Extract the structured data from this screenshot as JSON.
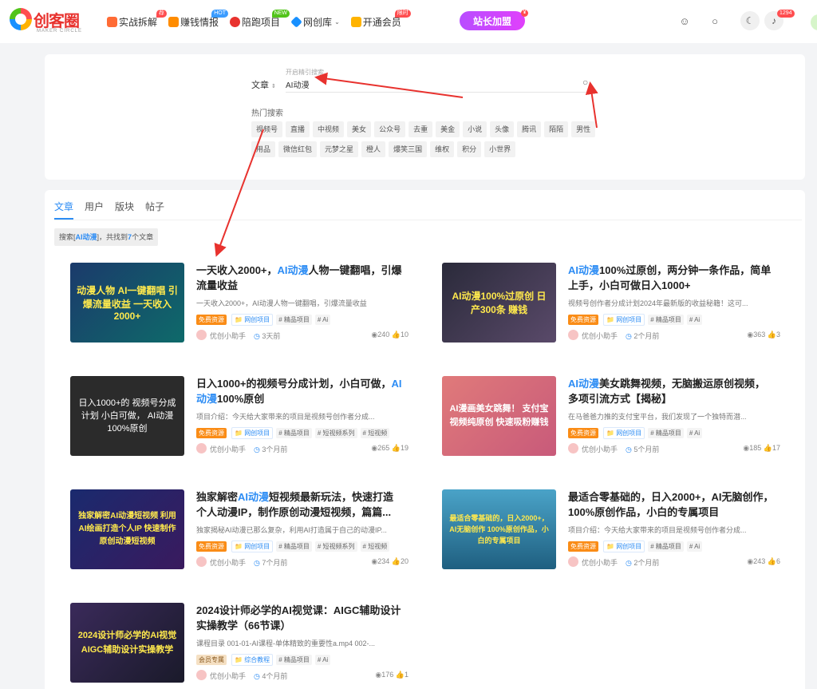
{
  "logo": {
    "name": "创客圈",
    "sub": "MAKER CIRCLE"
  },
  "nav": [
    {
      "label": "实战拆解",
      "badge": "荐",
      "badge_color": "#ff4d4f",
      "icon_color": "#ff6b35"
    },
    {
      "label": "赚钱情报",
      "badge": "HOT",
      "badge_color": "#3b9cff",
      "icon_color": "#ff8c00"
    },
    {
      "label": "陪跑项目",
      "badge": "NEW",
      "badge_color": "#52c41a",
      "icon_color": "#e8322e"
    },
    {
      "label": "网创库",
      "badge": "",
      "badge_color": "",
      "icon_color": "#1890ff",
      "dropdown": true
    },
    {
      "label": "开通会员",
      "badge": "限时",
      "badge_color": "#ff4d4f",
      "icon_color": "#ffb300"
    }
  ],
  "vip_button": {
    "label": "站长加盟",
    "dot": "¥"
  },
  "notifications": {
    "count": "1294"
  },
  "search": {
    "type": "文章",
    "hint": "开启精引搜索",
    "query": "AI动漫",
    "hot_label": "热门搜索",
    "hot_tags": [
      "视频号",
      "直播",
      "中视频",
      "美女",
      "公众号",
      "去重",
      "美金",
      "小说",
      "头像",
      "腾讯",
      "陌陌",
      "男性",
      "用品",
      "微信红包",
      "元梦之星",
      "橙人",
      "爆笑三国",
      "维权",
      "积分",
      "小世界"
    ]
  },
  "results": {
    "tabs": [
      "文章",
      "用户",
      "版块",
      "帖子"
    ],
    "active_tab": "文章",
    "summary": {
      "prefix": "搜索[",
      "keyword": "AI动漫",
      "middle": "]，共找到",
      "count": "7",
      "suffix": "个文章"
    },
    "cards": [
      {
        "title_pre": "一天收入2000+，",
        "title_kw": "AI动漫",
        "title_post": "人物一键翻唱，引爆流量收益",
        "desc": "一天收入2000+，AI动漫人物一键翻唱，引爆流量收益",
        "access": "免费资源",
        "category": "网创项目",
        "tags": [
          "# 精品项目",
          "# Ai"
        ],
        "author": "优创小助手",
        "time": "3天前",
        "views": "240",
        "likes": "10",
        "thumb_text": "动漫人物 AI一键翻唱 引爆流量收益 一天收入2000+",
        "thumb_bg": "#1b3a6b"
      },
      {
        "title_pre": "",
        "title_kw": "AI动漫",
        "title_post": "100%过原创，两分钟一条作品，简单上手，小白可做日入1000+",
        "desc": "视频号创作者分成计划2024年最新版的收益秘籍！这可...",
        "access": "免费资源",
        "category": "网创项目",
        "tags": [
          "# 精品项目",
          "# Ai"
        ],
        "author": "优创小助手",
        "time": "2个月前",
        "views": "363",
        "likes": "3",
        "thumb_text": "AI动漫100%过原创 日产300条 赚钱",
        "thumb_bg": "#2a2a3a"
      },
      {
        "title_pre": "日入1000+的视频号分成计划，小白可做，",
        "title_kw": "AI动漫",
        "title_post": "100%原创",
        "desc": "项目介绍：今天给大家带来的项目是视频号创作者分成...",
        "access": "免费资源",
        "category": "网创项目",
        "tags": [
          "# 精品项目",
          "# 短视频系列",
          "# 短视频"
        ],
        "author": "优创小助手",
        "time": "3个月前",
        "views": "265",
        "likes": "19",
        "thumb_text": "日入1000+的 视频号分成计划 小白可做， AI动漫100%原创",
        "thumb_bg": "#2b2b2b"
      },
      {
        "title_pre": "",
        "title_kw": "AI动漫",
        "title_post": "美女跳舞视频，无脑搬运原创视频，多项引流方式【揭秘】",
        "desc": "在马爸爸力推的支付宝平台，我们发现了一个独特而潜...",
        "access": "免费资源",
        "category": "网创项目",
        "tags": [
          "# 精品项目",
          "# Ai"
        ],
        "author": "优创小助手",
        "time": "5个月前",
        "views": "185",
        "likes": "17",
        "thumb_text": "AI漫画美女跳舞！ 支付宝视频纯原创 快速吸粉赚钱",
        "thumb_bg": "#e07a7a"
      },
      {
        "title_pre": "独家解密",
        "title_kw": "AI动漫",
        "title_post": "短视频最新玩法，快速打造个人动漫IP，制作原创动漫短视频，篇篇...",
        "desc": "独家揭秘AI动漫已那么复杂，利用AI打造属于自己的动漫IP...",
        "access": "免费资源",
        "category": "网创项目",
        "tags": [
          "# 精品项目",
          "# 短视频系列",
          "# 短视频"
        ],
        "author": "优创小助手",
        "time": "7个月前",
        "views": "234",
        "likes": "20",
        "thumb_text": "独家解密AI动漫短视频 利用AI绘画打造个人IP 快速制作原创动漫短视频",
        "thumb_bg": "#1a2a6e"
      },
      {
        "title_pre": "最适合零基础的，日入2000+，AI无脑创作，100%原创作品，小白的专属项目",
        "title_kw": "",
        "title_post": "",
        "desc": "项目介绍：今天给大家带来的项目是视频号创作者分成...",
        "access": "免费资源",
        "category": "网创项目",
        "tags": [
          "# 精品项目",
          "# Ai"
        ],
        "author": "优创小助手",
        "time": "2个月前",
        "views": "243",
        "likes": "6",
        "thumb_text": "最适合零基础的，日入2000+， AI无脑创作 100%原创作品，小白的专属项目",
        "thumb_bg": "#2f7fa8"
      },
      {
        "title_pre": "2024设计师必学的AI视觉课：AIGC辅助设计实操教学（66节课）",
        "title_kw": "",
        "title_post": "",
        "desc": "课程目录 001-01-AI课程-单体精致的重要性a.mp4 002-...",
        "access": "会员专属",
        "category": "综合教程",
        "tags": [
          "# 精品项目",
          "# Ai"
        ],
        "author": "优创小助手",
        "time": "4个月前",
        "views": "176",
        "likes": "1",
        "thumb_text": "2024设计师必学的AI视觉 AIGC辅助设计实操教学",
        "thumb_bg": "#3a2a5a"
      }
    ]
  }
}
